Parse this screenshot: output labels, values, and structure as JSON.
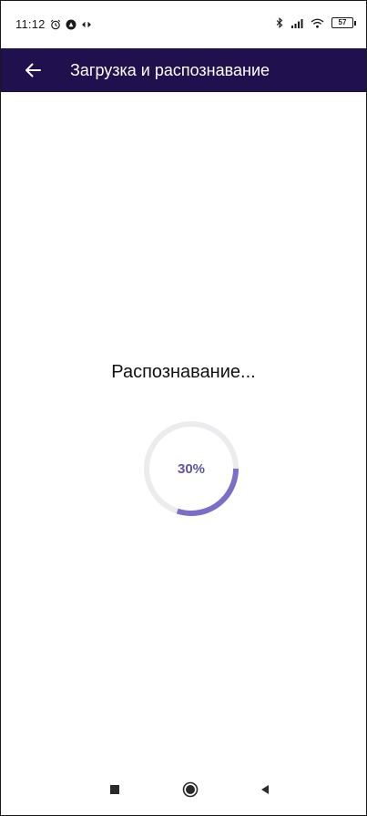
{
  "status_bar": {
    "time": "11:12",
    "battery": "57"
  },
  "app_bar": {
    "title": "Загрузка и распознавание"
  },
  "main": {
    "status_text": "Распознавание...",
    "progress_value": 0.3,
    "progress_label": "30%"
  },
  "colors": {
    "app_bar": "#20104e",
    "progress": "#7a6ec9",
    "progress_track": "#ececef"
  },
  "nav": {
    "icons": [
      "recents-icon",
      "home-icon",
      "back-nav-icon"
    ]
  }
}
